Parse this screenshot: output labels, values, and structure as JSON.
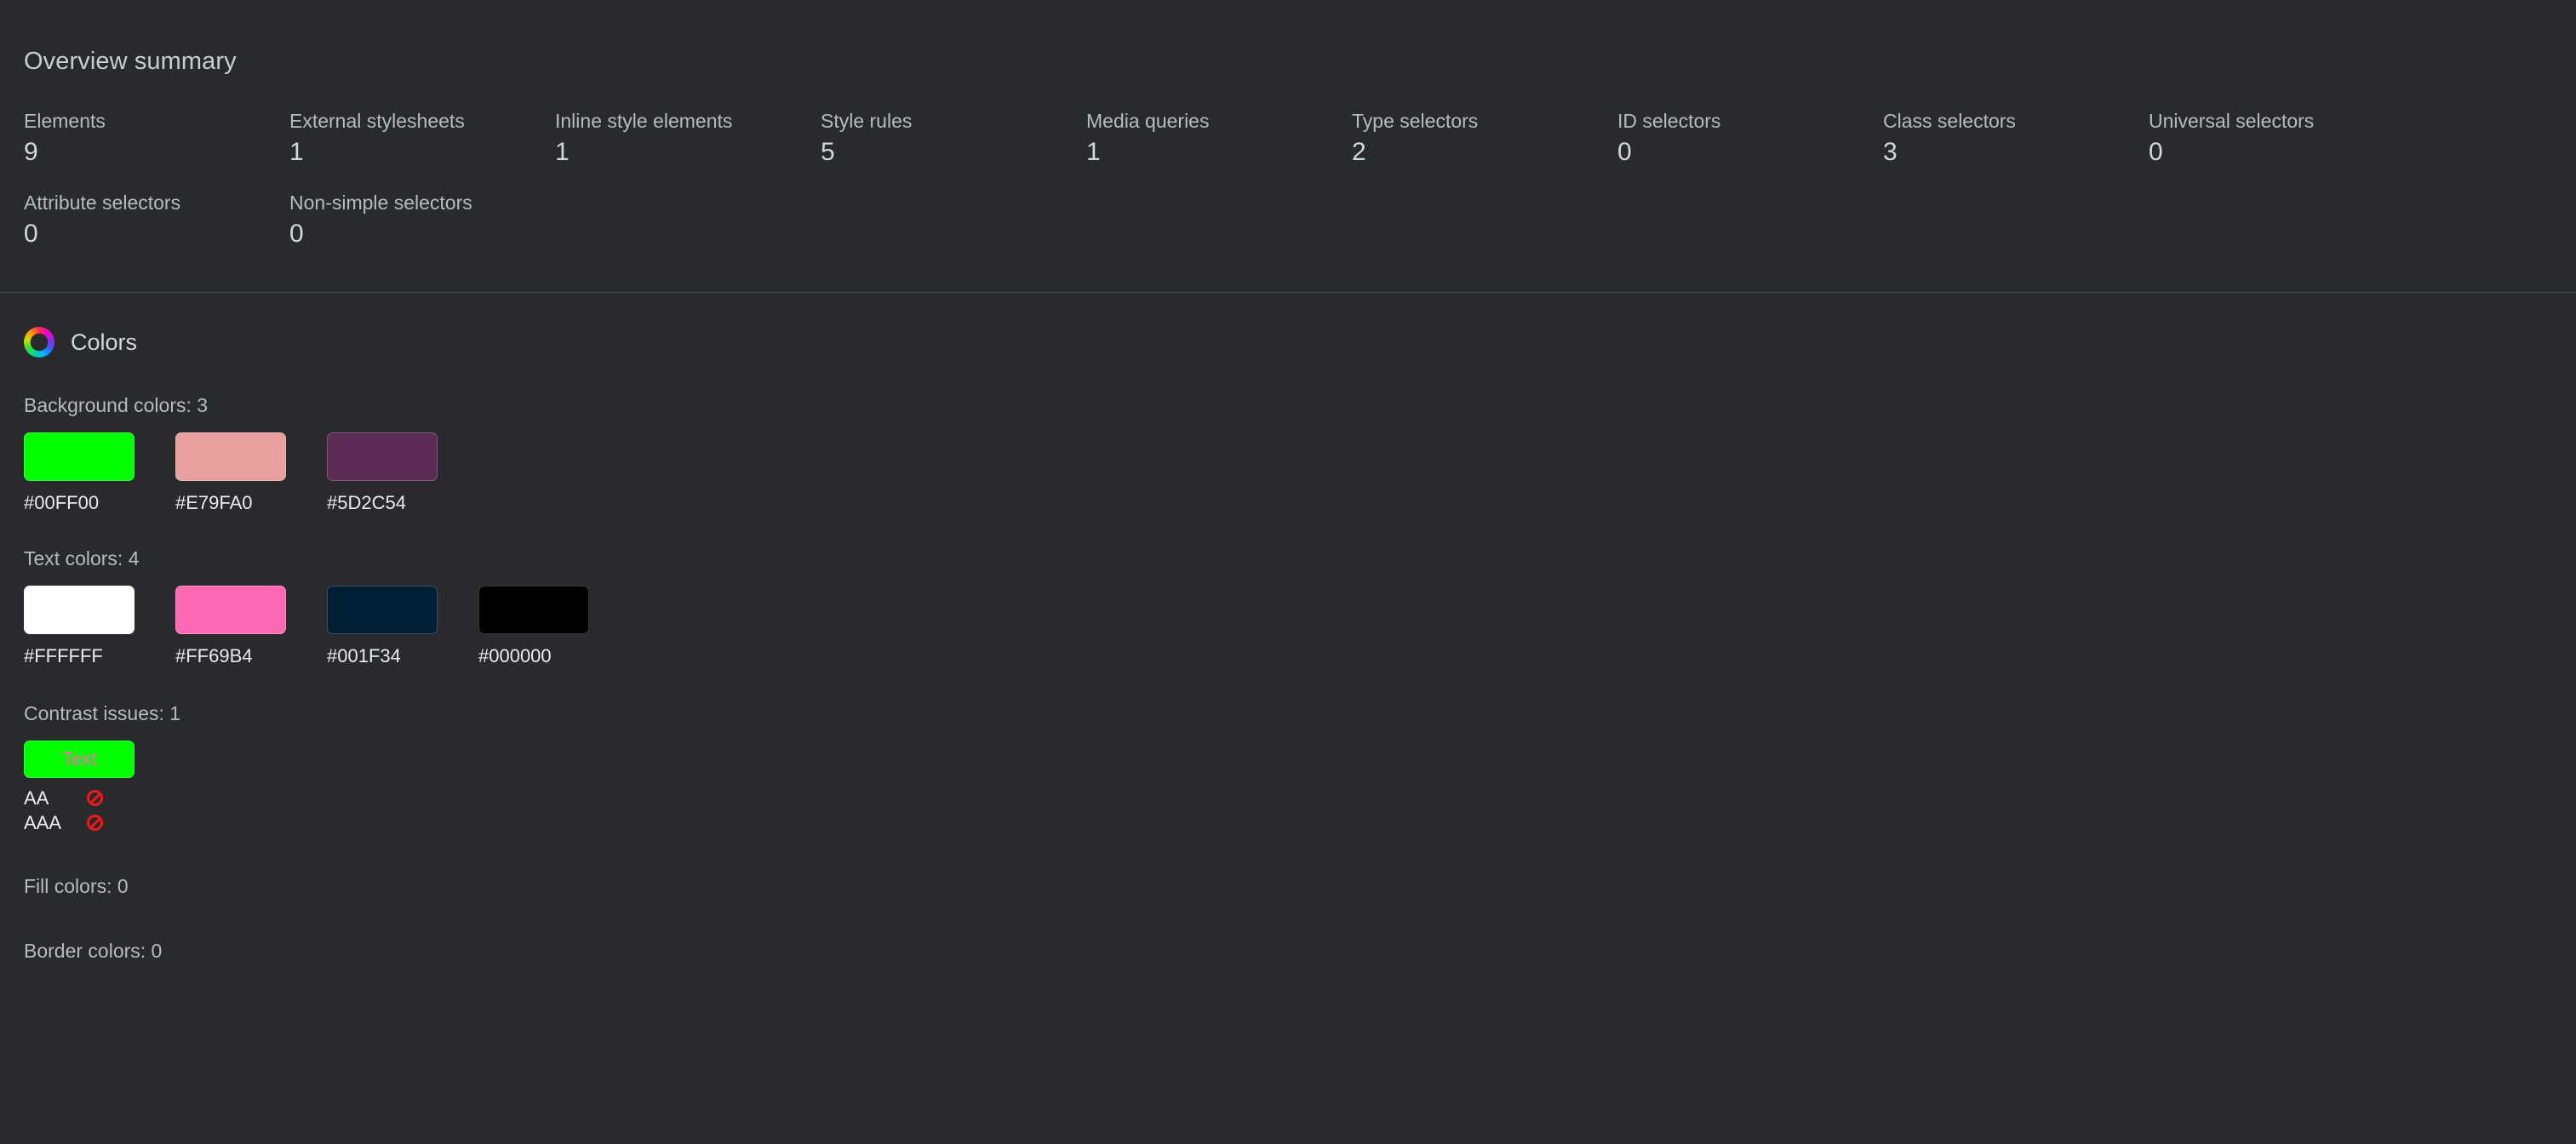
{
  "overview": {
    "title": "Overview summary",
    "stats": [
      {
        "label": "Elements",
        "value": "9"
      },
      {
        "label": "External stylesheets",
        "value": "1"
      },
      {
        "label": "Inline style elements",
        "value": "1"
      },
      {
        "label": "Style rules",
        "value": "5"
      },
      {
        "label": "Media queries",
        "value": "1"
      },
      {
        "label": "Type selectors",
        "value": "2"
      },
      {
        "label": "ID selectors",
        "value": "0"
      },
      {
        "label": "Class selectors",
        "value": "3"
      },
      {
        "label": "Universal selectors",
        "value": "0"
      },
      {
        "label": "Attribute selectors",
        "value": "0"
      },
      {
        "label": "Non-simple selectors",
        "value": "0"
      }
    ]
  },
  "colors": {
    "icon": "color-wheel-icon",
    "title": "Colors",
    "background": {
      "label": "Background colors: 3",
      "swatches": [
        {
          "code": "#00FF00"
        },
        {
          "code": "#E79FA0"
        },
        {
          "code": "#5D2C54"
        }
      ]
    },
    "text": {
      "label": "Text colors: 4",
      "swatches": [
        {
          "code": "#FFFFFF"
        },
        {
          "code": "#FF69B4"
        },
        {
          "code": "#001F34"
        },
        {
          "code": "#000000"
        }
      ]
    },
    "contrast": {
      "label": "Contrast issues: 1",
      "items": [
        {
          "sample_text": "Text",
          "background": "#00FF00",
          "foreground": "#FF69B4",
          "levels": [
            {
              "name": "AA",
              "status": "fail",
              "icon": "deny-icon"
            },
            {
              "name": "AAA",
              "status": "fail",
              "icon": "deny-icon"
            }
          ]
        }
      ]
    },
    "fill": {
      "label": "Fill colors: 0"
    },
    "border": {
      "label": "Border colors: 0"
    }
  }
}
